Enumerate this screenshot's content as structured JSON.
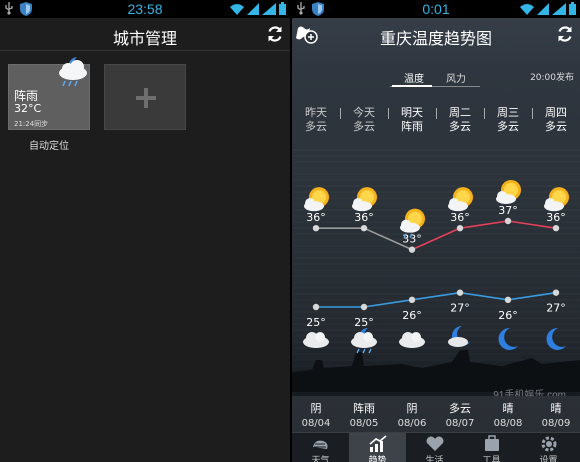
{
  "left": {
    "status": {
      "time": "23:58"
    },
    "header": {
      "title": "城市管理"
    },
    "city_card": {
      "condition": "阵雨",
      "temperature": "32°C",
      "sync_time": "21:24同步",
      "icon": "rain-cloud-night-icon"
    },
    "city_location": "自动定位",
    "add_city_icon": "plus-icon"
  },
  "right": {
    "status": {
      "time": "0:01"
    },
    "header": {
      "title": "重庆温度趋势图"
    },
    "tabs": {
      "temperature": "温度",
      "wind": "风力"
    },
    "published": "20:00发布",
    "forecast": [
      {
        "day": "昨天",
        "day_cond": "多云",
        "high": "36°",
        "low": "25°",
        "night_cond": "阴",
        "date": "08/04",
        "day_icon": "sun-cloud-icon",
        "night_icon": "cloud-icon"
      },
      {
        "day": "今天",
        "day_cond": "多云",
        "high": "36°",
        "low": "25°",
        "night_cond": "阵雨",
        "date": "08/05",
        "day_icon": "sun-cloud-icon",
        "night_icon": "rain-cloud-night-icon"
      },
      {
        "day": "明天",
        "day_cond": "阵雨",
        "high": "33°",
        "low": "26°",
        "night_cond": "阴",
        "date": "08/06",
        "day_icon": "sun-rain-icon",
        "night_icon": "cloud-icon"
      },
      {
        "day": "周二",
        "day_cond": "多云",
        "high": "36°",
        "low": "27°",
        "night_cond": "多云",
        "date": "08/07",
        "day_icon": "sun-cloud-icon",
        "night_icon": "moon-cloud-icon"
      },
      {
        "day": "周三",
        "day_cond": "多云",
        "high": "37°",
        "low": "26°",
        "night_cond": "晴",
        "date": "08/08",
        "day_icon": "sun-cloud-icon",
        "night_icon": "moon-icon"
      },
      {
        "day": "周四",
        "day_cond": "多云",
        "high": "36°",
        "low": "27°",
        "night_cond": "晴",
        "date": "08/09",
        "day_icon": "sun-cloud-icon",
        "night_icon": "moon-icon"
      }
    ],
    "nav": [
      {
        "label": "天气",
        "icon": "weather-icon"
      },
      {
        "label": "趋势",
        "icon": "trend-icon"
      },
      {
        "label": "生活",
        "icon": "heart-icon"
      },
      {
        "label": "工具",
        "icon": "tools-icon"
      },
      {
        "label": "设置",
        "icon": "settings-icon"
      }
    ],
    "watermark": "91手机娱乐 com"
  },
  "colors": {
    "status_accent": "#33b5e5",
    "high_line": "#e8405a",
    "low_line": "#3a9be0",
    "past_line": "#9a9a9a"
  },
  "chart_data": {
    "type": "line",
    "categories": [
      "昨天",
      "今天",
      "明天",
      "周二",
      "周三",
      "周四"
    ],
    "series": [
      {
        "values": [
          36,
          36,
          33,
          36,
          37,
          36
        ]
      },
      {
        "values": [
          25,
          25,
          26,
          27,
          26,
          27
        ]
      }
    ],
    "grid": false,
    "legend": "none"
  }
}
